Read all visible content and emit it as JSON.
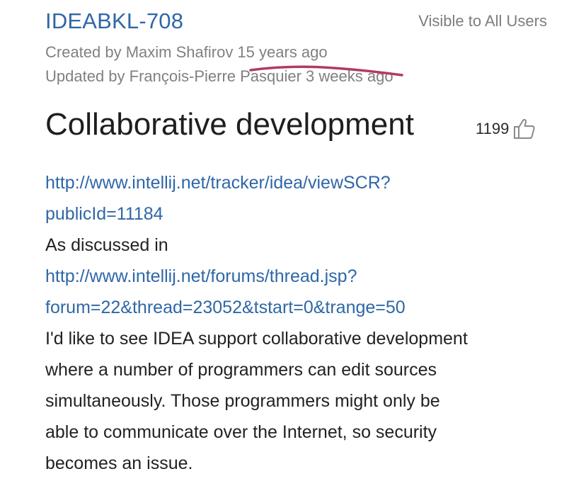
{
  "issue": {
    "id": "IDEABKL-708",
    "visibility": "Visible to All Users",
    "created": "Created by Maxim Shafirov 15 years ago",
    "updated": "Updated by François-Pierre Pasquier 3 weeks ago",
    "title": "Collaborative development",
    "votes": "1199",
    "vote_icon": "thumbs-up-icon"
  },
  "description": {
    "link1_part1": "http://www.intellij.net/tracker/idea/viewSCR?",
    "link1_part2": "publicId=11184",
    "discussed_in": "As discussed in",
    "link2_part1": "http://www.intellij.net/forums/thread.jsp?",
    "link2_part2": "forum=22&thread=23052&tstart=0&trange=50",
    "body_lines": [
      "I'd like to see IDEA support collaborative development",
      "where a number of programmers can edit sources",
      "simultaneously. Those programmers might only be",
      "able to communicate over the Internet, so security",
      "becomes an issue."
    ]
  },
  "colors": {
    "link": "#2f67a6",
    "meta_text": "#808080",
    "annotation_stroke": "#b23a63"
  }
}
